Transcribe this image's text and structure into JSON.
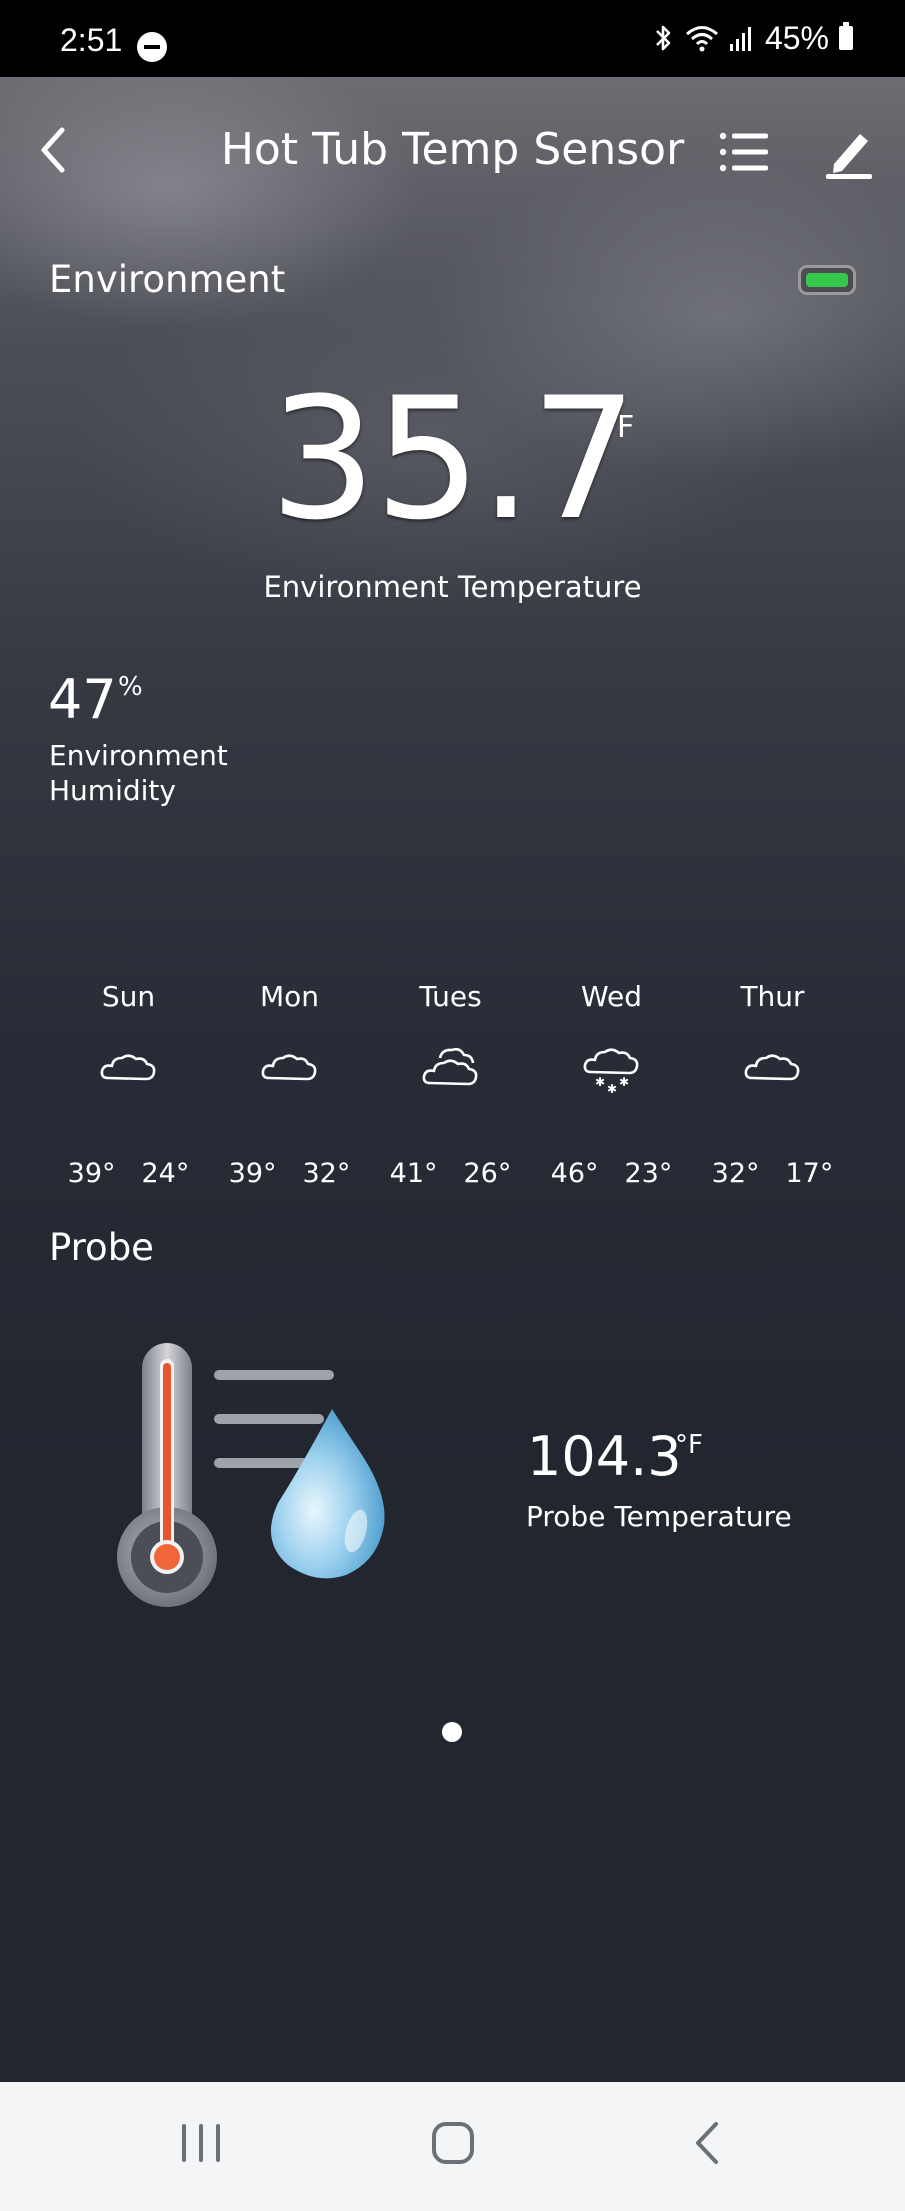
{
  "status_bar": {
    "time": "2:51",
    "battery_percent": "45%"
  },
  "header": {
    "title": "Hot Tub Temp Sensor"
  },
  "environment": {
    "section_title": "Environment",
    "battery_status_color": "#35c84b",
    "temperature": {
      "value": "35.7",
      "unit": "°F",
      "label": "Environment Temperature"
    },
    "humidity": {
      "value": "47",
      "unit": "%",
      "label": "Environment Humidity"
    }
  },
  "forecast": [
    {
      "day": "Sun",
      "icon": "cloud-icon",
      "high": "39°",
      "low": "24°"
    },
    {
      "day": "Mon",
      "icon": "cloud-icon",
      "high": "39°",
      "low": "32°"
    },
    {
      "day": "Tues",
      "icon": "cloudy-icon",
      "high": "41°",
      "low": "26°"
    },
    {
      "day": "Wed",
      "icon": "snow-icon",
      "high": "46°",
      "low": "23°"
    },
    {
      "day": "Thur",
      "icon": "cloud-icon",
      "high": "32°",
      "low": "17°"
    }
  ],
  "probe": {
    "section_title": "Probe",
    "illustration": "thermometer-water-icon",
    "temperature": {
      "value": "104.3",
      "unit": "°F",
      "label": "Probe Temperature"
    }
  },
  "pager": {
    "page_count": 1,
    "active_index": 0
  },
  "nav_bar": {
    "icons": [
      "recents-icon",
      "home-icon",
      "back-icon"
    ]
  }
}
